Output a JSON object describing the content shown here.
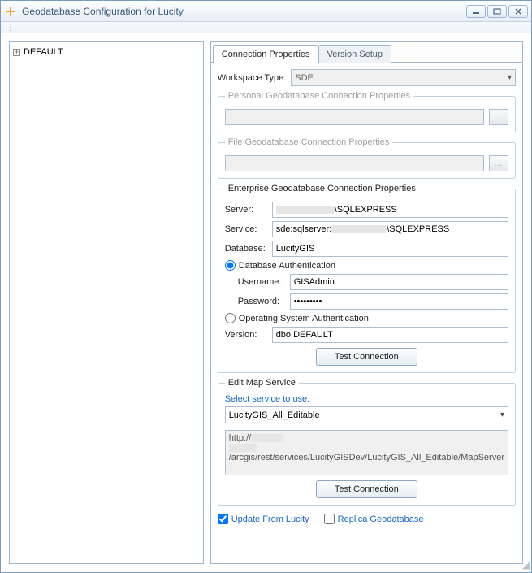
{
  "window": {
    "title": "Geodatabase Configuration for Lucity"
  },
  "tree": {
    "root_label": "DEFAULT"
  },
  "tabs": {
    "connection": "Connection Properties",
    "version": "Version Setup"
  },
  "workspace": {
    "label": "Workspace Type:",
    "value": "SDE"
  },
  "personal": {
    "legend": "Personal Geodatabase Connection Properties",
    "browse": "..."
  },
  "file": {
    "legend": "File Geodatabase Connection Properties",
    "browse": "..."
  },
  "enterprise": {
    "legend": "Enterprise Geodatabase Connection Properties",
    "server_label": "Server:",
    "server_value_suffix": "\\SQLEXPRESS",
    "service_label": "Service:",
    "service_value_prefix": "sde:sqlserver:",
    "service_value_suffix": "\\SQLEXPRESS",
    "database_label": "Database:",
    "database_value": "LucityGIS",
    "db_auth_label": "Database Authentication",
    "username_label": "Username:",
    "username_value": "GISAdmin",
    "password_label": "Password:",
    "password_value": "•••••••••",
    "os_auth_label": "Operating System Authentication",
    "version_label": "Version:",
    "version_value": "dbo.DEFAULT",
    "test_btn": "Test Connection"
  },
  "editmap": {
    "legend": "Edit Map Service",
    "select_label": "Select service to use:",
    "selected": "LucityGIS_All_Editable",
    "url_prefix": "http://",
    "url_suffix": "/arcgis/rest/services/LucityGISDev/LucityGIS_All_Editable/MapServer",
    "test_btn": "Test Connection"
  },
  "bottom": {
    "update_label": "Update From Lucity",
    "replica_label": "Replica Geodatabase"
  }
}
